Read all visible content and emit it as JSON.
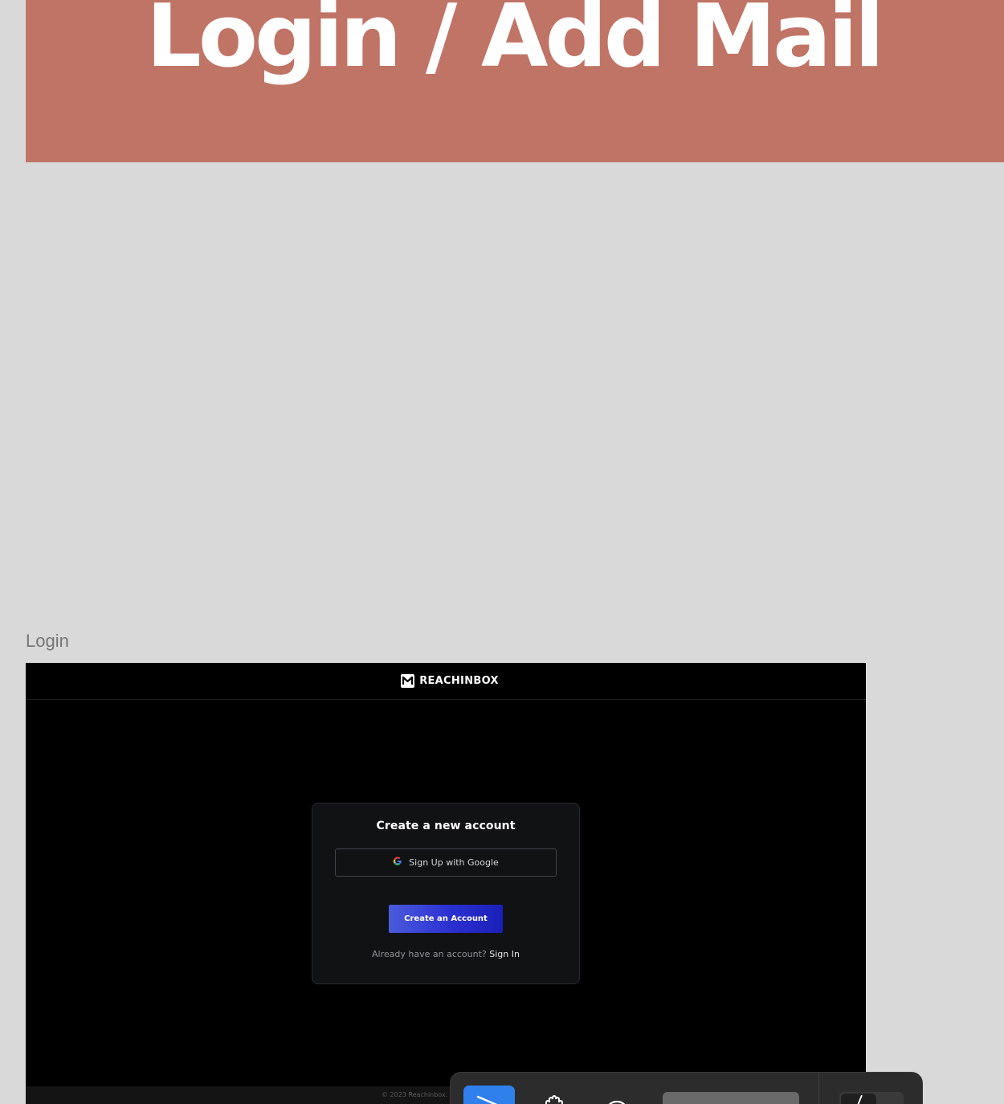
{
  "section": {
    "title": "Login / Add Mail",
    "banner_color": "#c07466"
  },
  "frame": {
    "label": "Login"
  },
  "app": {
    "brand_name": "REACHINBOX",
    "card": {
      "title": "Create a new account",
      "google_button": "Sign Up with Google",
      "create_button": "Create an Account",
      "signin_prompt": "Already have an account?",
      "signin_link": "Sign In"
    },
    "footer": "© 2023 Reachinbox."
  },
  "colors": {
    "canvas_bg": "#d9d9d9",
    "primary_button": "#2b2fd1",
    "toolbar_active": "#2f80ed"
  },
  "toolbar": {
    "tools": [
      "move-tool",
      "hand-tool",
      "comment-tool",
      "actions",
      "dev-mode-toggle"
    ]
  }
}
